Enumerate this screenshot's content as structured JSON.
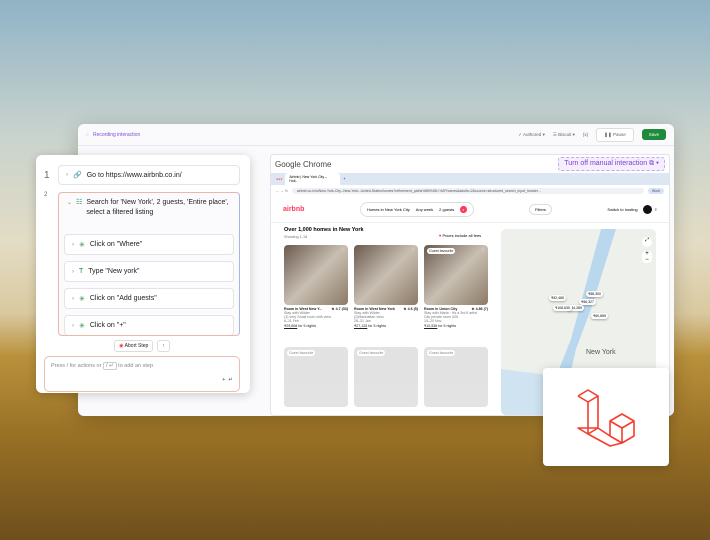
{
  "toolbar": {
    "recording": "Recording interaction",
    "authored": "Authored",
    "ai": "Biscuit",
    "vars": "{x}",
    "pause": "Pause",
    "save": "Save"
  },
  "steps": [
    {
      "num": "1",
      "label": "Go to https://www.airbnb.co.in/"
    },
    {
      "num": "2",
      "label": "Search for 'New York', 2 guests, 'Entire place', select a filtered listing"
    }
  ],
  "substeps": [
    "Click on \"Where\"",
    "Type \"New york\"",
    "Click on \"Add guests\"",
    "Click on \"+\""
  ],
  "abort": "Abort Step",
  "input_placeholder": "Press / for actions or",
  "input_key": "/ ↵",
  "input_suffix": "to add an step",
  "chrome": {
    "title": "Google Chrome",
    "turn_off": "Turn off manual interaction",
    "tab": "Airbnb | New York City – Holi...",
    "url": "airbnb.co.in/s/New-York-City--New-York--United-States/homes?refinement_paths%5B%5D=%2Fhomes&adults=2&source=structured_search_input_header...",
    "profile": "Work"
  },
  "airbnb": {
    "logo": "airbnb",
    "where": "Homes in New York City",
    "when": "Any week",
    "guests": "2 guests",
    "filters": "Filters",
    "host": "Switch to hosting",
    "heading": "Over 1,000 homes in New York",
    "showing": "Showing 1-18",
    "fees": "Prices include all fees",
    "listings": [
      {
        "title": "Room in West New Y...",
        "rating": "★ 4.7 (33)",
        "host": "Stay with Wilder",
        "desc": "(3) very Small room with view",
        "dates": "6–11 Feb",
        "price": "₹29,608",
        "per": "for 5 nights",
        "badge": ""
      },
      {
        "title": "Room in West New York",
        "rating": "★ 4.6 (5)",
        "host": "Stay with Wilder",
        "desc": "(2)Manhattan view",
        "dates": "26–31 Jan",
        "price": "₹27,125",
        "per": "for 5 nights",
        "badge": ""
      },
      {
        "title": "Room in Union City",
        "rating": "★ 4.86 (7)",
        "host": "Stay with Marla · It's a 3rd fl artist",
        "desc": "City private room #26",
        "dates": "15–20 Nov",
        "price": "₹10,536",
        "per": "for 5 nights",
        "badge": "Guest favourite"
      }
    ],
    "badges2": [
      "Guest favourite",
      "Guest favourite",
      "Guest favourite"
    ],
    "map_label": "New York",
    "map_prices": [
      "₹58,300",
      "₹56,327",
      "₹60,855",
      "₹44,289",
      "₹108,630",
      "₹92,465"
    ]
  }
}
